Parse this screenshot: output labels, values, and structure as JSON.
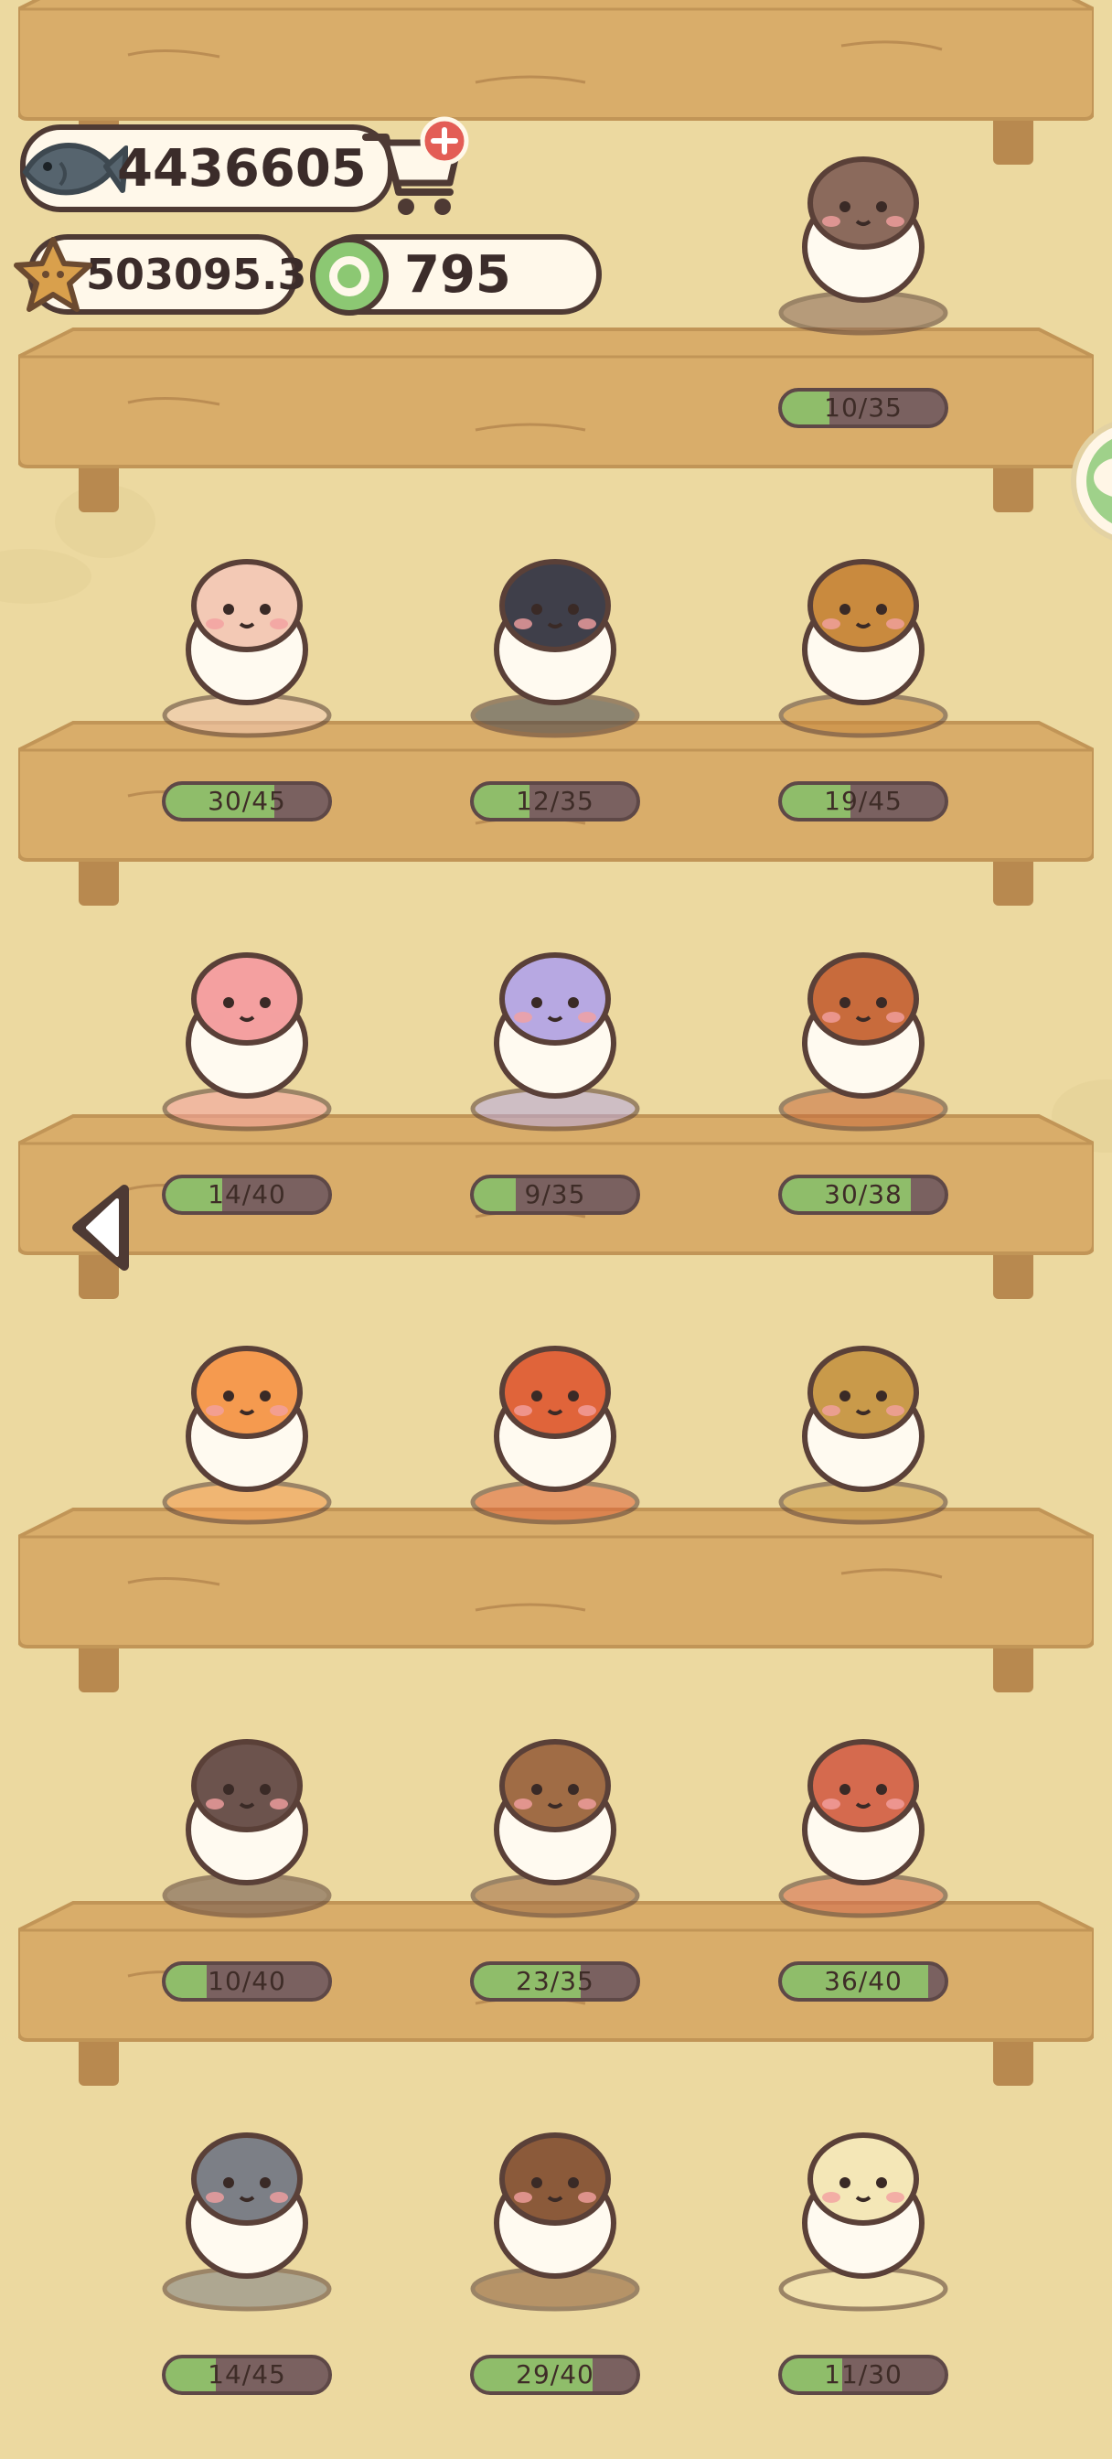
{
  "currencies": {
    "fish": "4436605",
    "star": "503095.3",
    "coin": "795"
  },
  "icons": {
    "fish": "fish-icon",
    "cart": "shop-cart-plus-icon",
    "star": "star-cookie-icon",
    "coin": "green-coin-icon",
    "chat": "chat-bubble-icon",
    "back": "left-arrow-icon"
  },
  "collection": {
    "rows": [
      {
        "items": [
          {
            "name": "figure-hidden-1",
            "progress": "",
            "fraction": 0
          },
          {
            "name": "figure-hidden-2",
            "progress": "",
            "fraction": 0
          },
          {
            "name": "figure-candy-cane-dog",
            "progress": "10/35",
            "fraction": 0.29,
            "color": "#8b6a5c"
          }
        ]
      },
      {
        "items": [
          {
            "name": "figure-lemonade-cat",
            "progress": "30/45",
            "fraction": 0.67,
            "color": "#f3c9b5"
          },
          {
            "name": "figure-toy-penguin",
            "progress": "12/35",
            "fraction": 0.34,
            "color": "#3f3f4a"
          },
          {
            "name": "figure-lion-dog",
            "progress": "19/45",
            "fraction": 0.42,
            "color": "#c98a3e"
          }
        ]
      },
      {
        "items": [
          {
            "name": "figure-nurse-cat",
            "progress": "14/40",
            "fraction": 0.35,
            "color": "#f4a0a0"
          },
          {
            "name": "figure-koala-cloud",
            "progress": "9/35",
            "fraction": 0.26,
            "color": "#b7a8e2"
          },
          {
            "name": "figure-panda-gold",
            "progress": "30/38",
            "fraction": 0.79,
            "color": "#c86b3c"
          }
        ]
      },
      {
        "items": [
          {
            "name": "figure-bunny-chair",
            "progress": "",
            "fraction": 0,
            "color": "#f59a4f"
          },
          {
            "name": "figure-tomato-dog",
            "progress": "",
            "fraction": 0,
            "color": "#e0643a"
          },
          {
            "name": "figure-volleyball-lynx",
            "progress": "",
            "fraction": 0,
            "color": "#c99a4a"
          }
        ]
      },
      {
        "items": [
          {
            "name": "figure-tophat-raccoon",
            "progress": "10/40",
            "fraction": 0.25,
            "color": "#6c534d"
          },
          {
            "name": "figure-cowboy-cat",
            "progress": "23/35",
            "fraction": 0.66,
            "color": "#a06c45"
          },
          {
            "name": "figure-jester-cat",
            "progress": "36/40",
            "fraction": 0.9,
            "color": "#d56a4e"
          }
        ]
      },
      {
        "items": [
          {
            "name": "figure-bride-wolf",
            "progress": "14/45",
            "fraction": 0.31,
            "color": "#7c7f86"
          },
          {
            "name": "figure-flower-lion",
            "progress": "29/40",
            "fraction": 0.73,
            "color": "#8b5a3a"
          },
          {
            "name": "figure-baker-bear",
            "progress": "11/30",
            "fraction": 0.37,
            "color": "#f4e7b7"
          }
        ]
      }
    ]
  }
}
